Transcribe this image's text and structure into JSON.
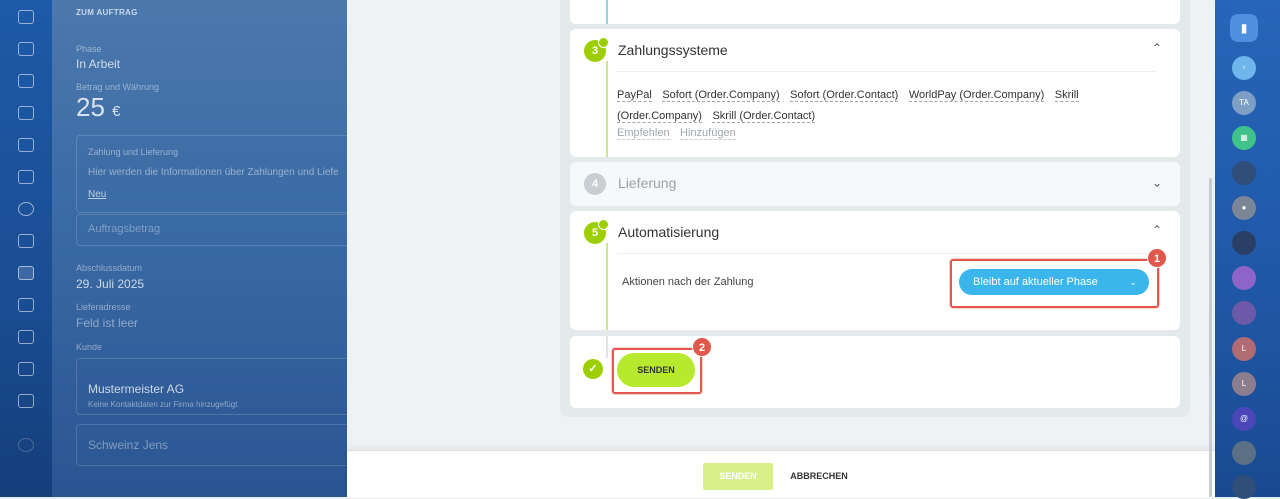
{
  "left_panel": {
    "header": "ZUM AUFTRAG",
    "phase_label": "Phase",
    "phase_value": "In Arbeit",
    "amount_label": "Betrag und Währung",
    "amount_value": "25",
    "currency": "€",
    "payment_section_title": "Zahlung und Lieferung",
    "payment_section_text": "Hier werden die Informationen über Zahlungen und Liefe",
    "new_link": "Neu",
    "order_amount_label": "Auftragsbetrag",
    "close_date_label": "Abschlussdatum",
    "close_date_value": "29. Juli 2025",
    "address_label": "Lieferadresse",
    "address_value": "Feld ist leer",
    "client_label": "Kunde",
    "company_value": "Mustermeister AG",
    "company_sub": "Keine Kontaktdaten zur Firma hinzugefügt",
    "contact_value": "Schweinz Jens"
  },
  "cards": {
    "payment_systems": {
      "step": "3",
      "title": "Zahlungssysteme",
      "systems": [
        "PayPal",
        "Sofort (Order.Company)",
        "Sofort (Order.Contact)",
        "WorldPay (Order.Company)",
        "Skrill (Order.Company)",
        "Skrill (Order.Contact)"
      ],
      "recommend_link": "Empfehlen",
      "add_link": "Hinzufügen"
    },
    "delivery": {
      "step": "4",
      "title": "Lieferung"
    },
    "automation": {
      "step": "5",
      "title": "Automatisierung",
      "action_label": "Aktionen nach der Zahlung",
      "dropdown_value": "Bleibt auf aktueller Phase"
    },
    "send": {
      "button_label": "SENDEN"
    }
  },
  "annotations": {
    "badge_1": "1",
    "badge_2": "2",
    "highlight_color": "#e2574c"
  },
  "footer": {
    "send_label": "SENDEN",
    "cancel_label": "ABBRECHEN"
  },
  "right_bar": {
    "user_initials": "TA",
    "letter_1": "L",
    "letter_2": "L"
  },
  "colors": {
    "accent_green": "#9dcf00",
    "send_button": "#b7ea2e",
    "dropdown_blue": "#3bb6ec",
    "nav_blue": "#1e5aa8"
  }
}
